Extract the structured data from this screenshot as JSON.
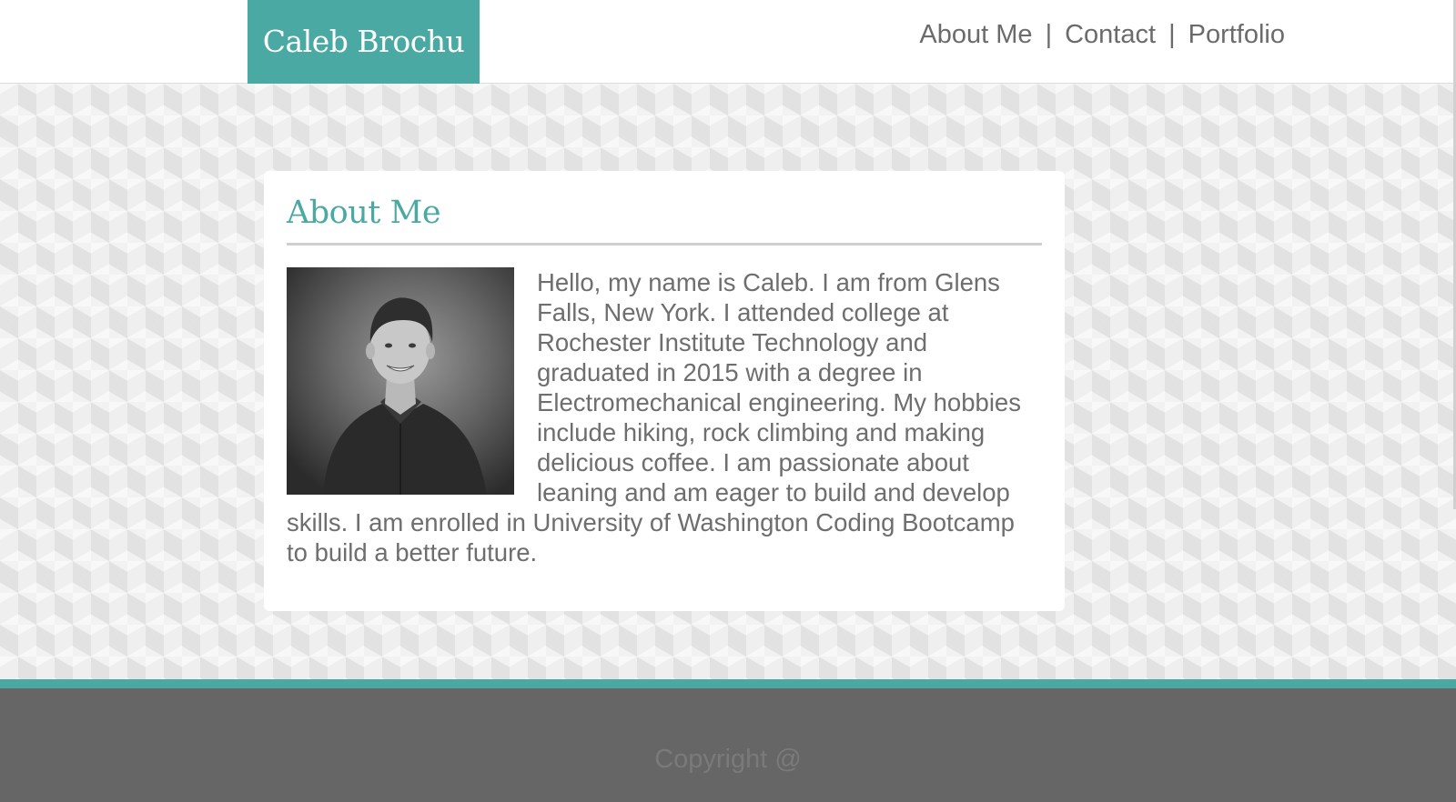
{
  "header": {
    "brand": "Caleb Brochu",
    "nav": [
      {
        "label": "About Me"
      },
      {
        "label": "Contact"
      },
      {
        "label": "Portfolio"
      }
    ],
    "separator": "|"
  },
  "about": {
    "title": "About Me",
    "bio": "Hello, my name is Caleb. I am from Glens Falls, New York. I attended college at Rochester Institute Technology and graduated in 2015 with a degree in Electromechanical engineering. My hobbies include hiking, rock climbing and making delicious coffee. I am passionate about leaning and am eager to build and develop skills. I am enrolled in University of Washington Coding Bootcamp to build a better future."
  },
  "footer": {
    "copyright": "Copyright @"
  },
  "colors": {
    "accent": "#4aa9a3",
    "text": "#6e6e6e",
    "footer": "#666666"
  }
}
